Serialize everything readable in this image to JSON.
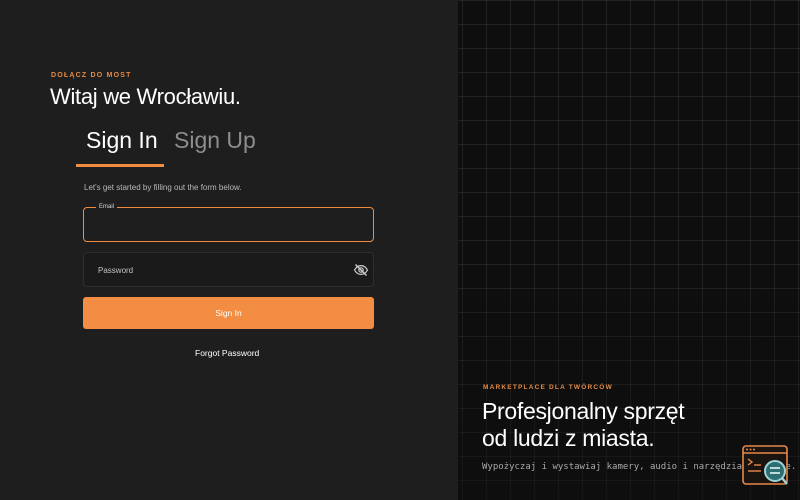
{
  "left": {
    "eyebrow": "DOŁĄCZ DO MOST",
    "welcome": "Witaj we Wrocławiu.",
    "tabs": [
      {
        "label": "Sign In",
        "active": true
      },
      {
        "label": "Sign Up",
        "active": false
      }
    ],
    "intro": "Let's get started by filling out the form below.",
    "email": {
      "label": "Email",
      "value": ""
    },
    "password": {
      "placeholder": "Password",
      "toggle_icon": "eye-off-icon"
    },
    "sign_in_button": "Sign In",
    "forgot_password": "Forgot Password"
  },
  "right": {
    "eyebrow": "MARKETPLACE DLA TWÓRCÓW",
    "title_line1": "Profesjonalny sprzęt",
    "title_line2": "od ludzi z miasta.",
    "subtitle": "Wypożyczaj i wystawiaj kamery, audio i narzędzia lokalnie.",
    "widget_icon": "terminal-search-icon"
  },
  "colors": {
    "accent": "#f28d43",
    "left_bg": "#1e1e1e",
    "right_bg": "#0e0e0e"
  }
}
